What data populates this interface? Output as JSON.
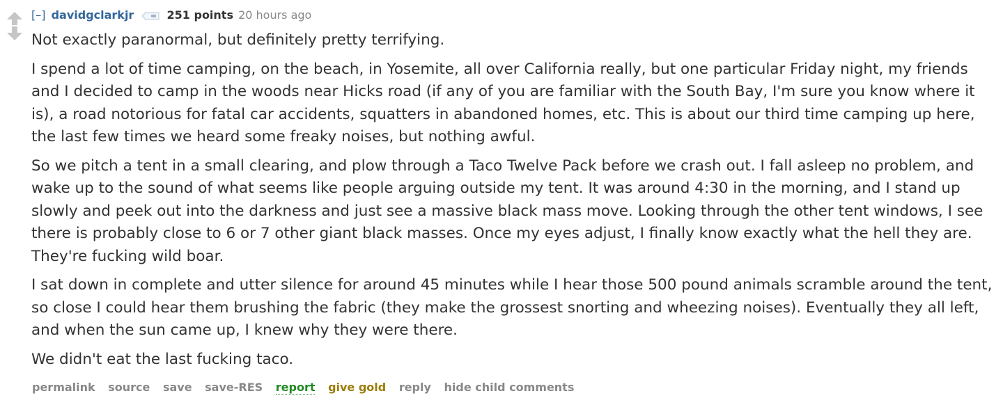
{
  "vote": {
    "upvote_icon": "arrow-up-icon",
    "downvote_icon": "arrow-down-icon"
  },
  "tagline": {
    "toggle": "[–]",
    "author": "davidgclarkjr",
    "tag_icon": "tag-icon",
    "score": "251 points",
    "time": "20 hours ago"
  },
  "comment": {
    "paragraphs": [
      "Not exactly paranormal, but definitely pretty terrifying.",
      "I spend a lot of time camping, on the beach, in Yosemite, all over California really, but one particular Friday night, my friends and I decided to camp in the woods near Hicks road (if any of you are familiar with the South Bay, I'm sure you know where it is), a road notorious for fatal car accidents, squatters in abandoned homes, etc. This is about our third time camping up here, the last few times we heard some freaky noises, but nothing awful.",
      "So we pitch a tent in a small clearing, and plow through a Taco Twelve Pack before we crash out. I fall asleep no problem, and wake up to the sound of what seems like people arguing outside my tent. It was around 4:30 in the morning, and I stand up slowly and peek out into the darkness and just see a massive black mass move. Looking through the other tent windows, I see there is probably close to 6 or 7 other giant black masses. Once my eyes adjust, I finally know exactly what the hell they are. They're fucking wild boar.",
      "I sat down in complete and utter silence for around 45 minutes while I hear those 500 pound animals scramble around the tent, so close I could hear them brushing the fabric (they make the grossest snorting and wheezing noises). Eventually they all left, and when the sun came up, I knew why they were there.",
      "We didn't eat the last fucking taco."
    ]
  },
  "buttons": {
    "permalink": "permalink",
    "source": "source",
    "save": "save",
    "save_res": "save-RES",
    "report": "report",
    "give_gold": "give gold",
    "reply": "reply",
    "hide_child": "hide child comments"
  },
  "colors": {
    "author": "#336699",
    "report": "#228822",
    "gold": "#9a7d0a",
    "muted": "#888888",
    "text": "#333333"
  }
}
